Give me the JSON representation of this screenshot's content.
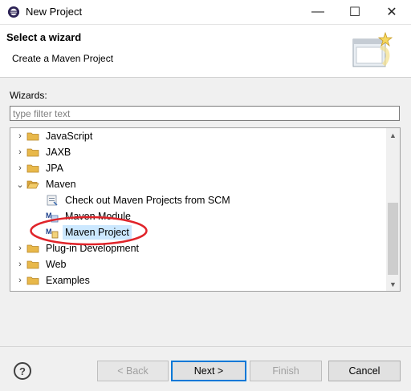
{
  "window": {
    "title": "New Project",
    "min_glyph": "—",
    "max_glyph": "☐",
    "close_glyph": "✕"
  },
  "banner": {
    "title": "Select a wizard",
    "description": "Create a Maven Project"
  },
  "wizards": {
    "label": "Wizards:",
    "filter_placeholder": "type filter text",
    "filter_value": ""
  },
  "tree": {
    "items": [
      {
        "label": "JavaScript",
        "expanded": false,
        "icon": "folder-icon",
        "level": 0
      },
      {
        "label": "JAXB",
        "expanded": false,
        "icon": "folder-icon",
        "level": 0
      },
      {
        "label": "JPA",
        "expanded": false,
        "icon": "folder-icon",
        "level": 0
      },
      {
        "label": "Maven",
        "expanded": true,
        "icon": "folder-open-icon",
        "level": 0
      },
      {
        "label": "Check out Maven Projects from SCM",
        "icon": "scm-checkout-icon",
        "level": 1
      },
      {
        "label": "Maven Module",
        "icon": "maven-module-icon",
        "level": 1
      },
      {
        "label": "Maven Project",
        "icon": "maven-project-icon",
        "level": 1,
        "selected": true
      },
      {
        "label": "Plug-in Development",
        "expanded": false,
        "icon": "folder-icon",
        "level": 0
      },
      {
        "label": "Web",
        "expanded": false,
        "icon": "folder-icon",
        "level": 0
      },
      {
        "label": "Examples",
        "expanded": false,
        "icon": "folder-icon",
        "level": 0
      }
    ]
  },
  "buttons": {
    "help": "?",
    "back": "< Back",
    "next": "Next >",
    "finish": "Finish",
    "cancel": "Cancel"
  },
  "colors": {
    "selection": "#cce8ff",
    "annotation": "#e0242a",
    "default_button_border": "#0078d7",
    "folder": "#e8b84a"
  }
}
